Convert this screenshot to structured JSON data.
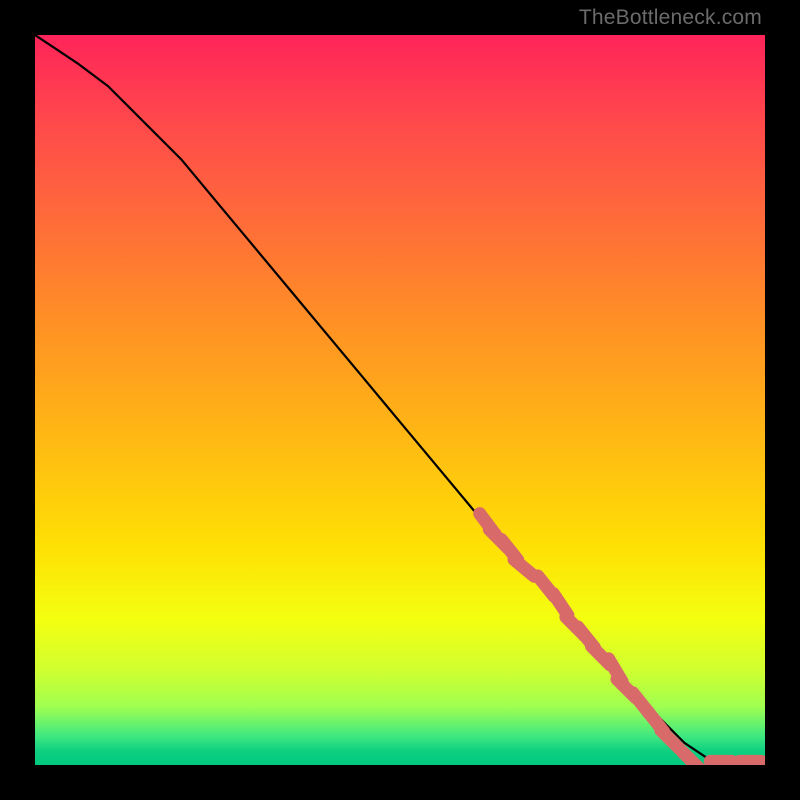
{
  "watermark": "TheBottleneck.com",
  "colors": {
    "background": "#000000",
    "line": "#000000",
    "marker": "#d86a6a",
    "gradient_top": "#ff245a",
    "gradient_bottom": "#00c97f"
  },
  "chart_data": {
    "type": "line",
    "title": "",
    "xlabel": "",
    "ylabel": "",
    "xlim": [
      0,
      100
    ],
    "ylim": [
      0,
      100
    ],
    "legend": false,
    "grid": false,
    "series": [
      {
        "name": "curve",
        "x": [
          0,
          3,
          6,
          10,
          15,
          20,
          25,
          30,
          35,
          40,
          45,
          50,
          55,
          60,
          65,
          70,
          75,
          80,
          83,
          86,
          89,
          92,
          95,
          98,
          100
        ],
        "y": [
          100,
          98,
          96,
          93,
          88,
          83,
          77,
          71,
          65,
          59,
          53,
          47,
          41,
          35,
          29,
          24,
          18,
          12,
          9,
          6,
          3,
          1,
          0.5,
          0.5,
          0.5
        ]
      }
    ],
    "markers": [
      {
        "x": 62,
        "y": 33
      },
      {
        "x": 63.5,
        "y": 31
      },
      {
        "x": 65,
        "y": 29.5
      },
      {
        "x": 67,
        "y": 27
      },
      {
        "x": 70,
        "y": 24.5
      },
      {
        "x": 72,
        "y": 22
      },
      {
        "x": 74,
        "y": 19
      },
      {
        "x": 75.5,
        "y": 17.5
      },
      {
        "x": 77.5,
        "y": 15
      },
      {
        "x": 79.5,
        "y": 13
      },
      {
        "x": 81,
        "y": 10.5
      },
      {
        "x": 83,
        "y": 8.5
      },
      {
        "x": 85,
        "y": 6
      },
      {
        "x": 87,
        "y": 3.5
      },
      {
        "x": 90,
        "y": 0.5
      },
      {
        "x": 94,
        "y": 0.5
      },
      {
        "x": 98,
        "y": 0.5
      }
    ]
  }
}
